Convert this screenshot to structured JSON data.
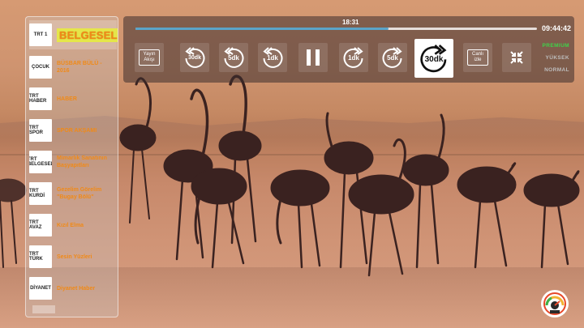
{
  "colors": {
    "channel_text": "#f08a18",
    "active_highlight": "#e5e64a",
    "progress_fill": "#5aa4c9",
    "quality_selected": "#3fd24a",
    "quality_unselected": "#bdbdbd"
  },
  "player": {
    "elapsed": "18:31",
    "clock": "09:44:42",
    "progress": 0.63
  },
  "controls": {
    "guide": {
      "label": "Yayın Akışı",
      "icon": "tv-guide-icon"
    },
    "back_30": "30dk",
    "back_5": "5dk",
    "back_1": "1dk",
    "pause": {
      "icon": "pause-icon"
    },
    "fwd_1": "1dk",
    "fwd_5": "5dk",
    "fwd_30": "30dk",
    "live": {
      "label": "Canlı izle"
    },
    "fullscreen": {
      "icon": "collapse-icon"
    }
  },
  "quality": {
    "options": [
      "PREMIUM",
      "YÜKSEK",
      "NORMAL"
    ],
    "selected": "PREMIUM"
  },
  "channels": [
    {
      "logo": "TRT 1",
      "name": "BELGESEL",
      "active": true
    },
    {
      "logo": "ÇOCUK",
      "name": "BÜSBAR BÜLÜ - 2016",
      "active": false
    },
    {
      "logo": "TRT HABER",
      "name": "HABER",
      "active": false
    },
    {
      "logo": "TRT SPOR",
      "name": "SPOR AKŞAMI",
      "active": false
    },
    {
      "logo": "TRT BELGESEL",
      "name": "Mimarlık Sanatının Başyapıtları",
      "active": false
    },
    {
      "logo": "TRT KURDİ",
      "name": "Gezelim Görelim \"Bugay Bölü\"",
      "active": false
    },
    {
      "logo": "TRT AVAZ",
      "name": "Kızıl Elma",
      "active": false
    },
    {
      "logo": "TRT TÜRK",
      "name": "Sesin Yüzleri",
      "active": false
    },
    {
      "logo": "DİYANET",
      "name": "Diyanet Haber",
      "active": false
    }
  ]
}
